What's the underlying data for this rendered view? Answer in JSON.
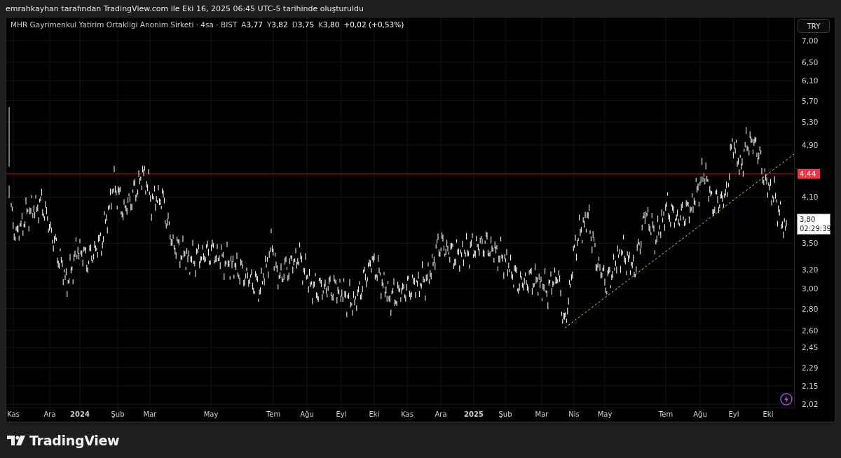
{
  "attribution": "emrahkayhan tarafından TradingView.com ile Eki 16, 2025 06:45 UTC-5 tarihinde oluşturuldu",
  "legend": {
    "title": "MHR Gayrimenkul Yatirim Ortakligi Anonim Sirketi · 4sa · BIST",
    "values": [
      {
        "label": "A",
        "value": "3,77"
      },
      {
        "label": "Y",
        "value": "3,82"
      },
      {
        "label": "D",
        "value": "3,75"
      },
      {
        "label": "K",
        "value": "3,80"
      }
    ],
    "change": "+0,02 (+0,53%)"
  },
  "currency": "TRY",
  "price_scale": [
    "7,00",
    "6,50",
    "6,10",
    "5,70",
    "5,30",
    "4,90",
    "4,10",
    "3,50",
    "3,20",
    "3,00",
    "2,80",
    "2,60",
    "2,45",
    "2,29",
    "2,15",
    "2,02"
  ],
  "price_line": {
    "label": "4,44"
  },
  "current_price": {
    "price": "3,80",
    "countdown": "02:29:39"
  },
  "time_axis": [
    {
      "label": "Kas",
      "kind": "month"
    },
    {
      "label": "Ara",
      "kind": "month"
    },
    {
      "label": "2024",
      "kind": "year"
    },
    {
      "label": "Şub",
      "kind": "month"
    },
    {
      "label": "Mar",
      "kind": "month"
    },
    {
      "label": "May",
      "kind": "month"
    },
    {
      "label": "Tem",
      "kind": "month"
    },
    {
      "label": "Ağu",
      "kind": "month"
    },
    {
      "label": "Eyl",
      "kind": "month"
    },
    {
      "label": "Eki",
      "kind": "month"
    },
    {
      "label": "Kas",
      "kind": "month"
    },
    {
      "label": "Ara",
      "kind": "month"
    },
    {
      "label": "2025",
      "kind": "year"
    },
    {
      "label": "Şub",
      "kind": "month"
    },
    {
      "label": "Mar",
      "kind": "month"
    },
    {
      "label": "Nis",
      "kind": "month"
    },
    {
      "label": "May",
      "kind": "month"
    },
    {
      "label": "Tem",
      "kind": "month"
    },
    {
      "label": "Ağu",
      "kind": "month"
    },
    {
      "label": "Eyl",
      "kind": "month"
    },
    {
      "label": "Eki",
      "kind": "month"
    }
  ],
  "brand": "TradingView"
}
